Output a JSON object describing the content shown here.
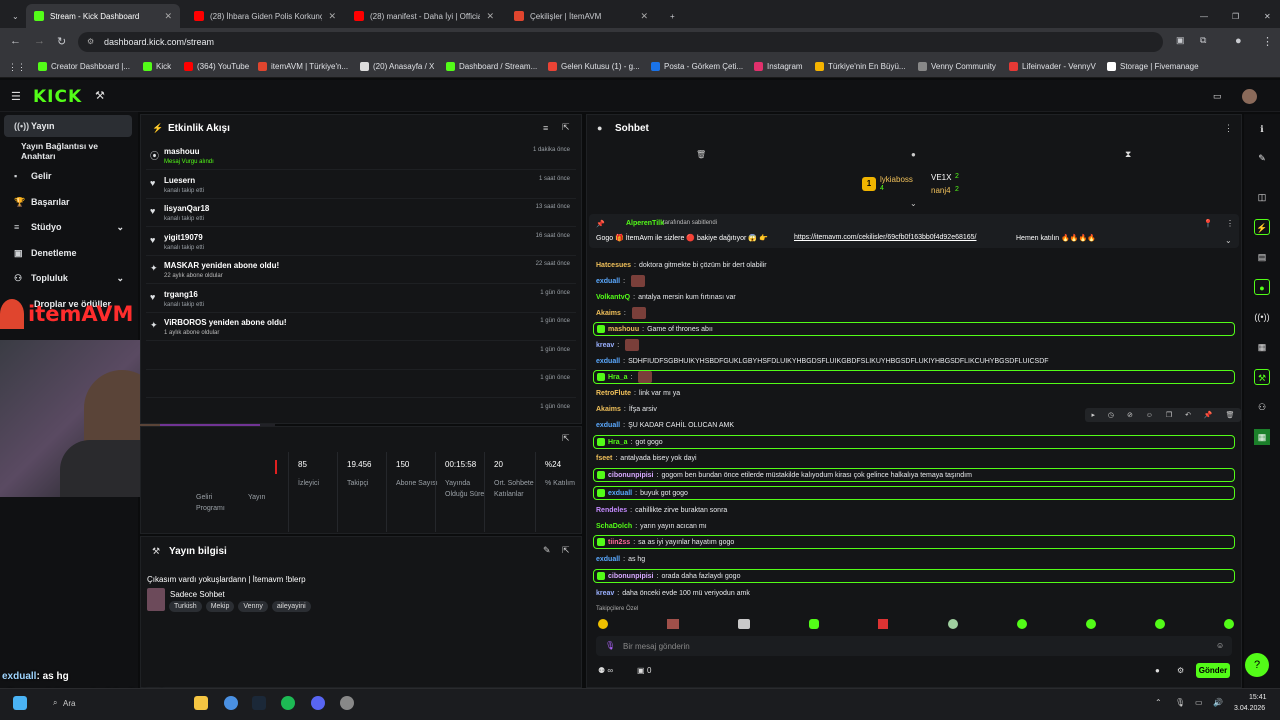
{
  "browser": {
    "tabs": [
      {
        "label": "Stream - Kick Dashboard",
        "color": "#53fc18"
      },
      {
        "label": "(28) İhbara Giden Polis Korkunç",
        "color": "#ff0000"
      },
      {
        "label": "(28) manifest - Daha İyi | Officia",
        "color": "#ff0000"
      },
      {
        "label": "Çekilişler | İtemAVM",
        "color": "#e0452e"
      }
    ],
    "url": "dashboard.kick.com/stream",
    "bookmarks": [
      "Creator Dashboard |...",
      "Kick",
      "(364) YouTube",
      "itemAVM | Türkiye'n...",
      "(20) Anasayfa / X",
      "Dashboard / Stream...",
      "Gelen Kutusu (1) - g...",
      "Posta - Görkem Çeti...",
      "Instagram",
      "Türkiye'nin En Büyü...",
      "Venny Community",
      "Lifeinvader - VennyV",
      "Storage | Fivemanage"
    ]
  },
  "kick": {
    "logo": "KICK"
  },
  "sidebar": {
    "items": [
      {
        "label": "Yayın",
        "icon": "((•))"
      },
      {
        "label": "Yayın Bağlantısı ve Anahtarı",
        "icon": ""
      },
      {
        "label": "Gelir",
        "icon": "▪"
      },
      {
        "label": "Başarılar",
        "icon": "🏆"
      },
      {
        "label": "Stüdyo",
        "icon": "≡"
      },
      {
        "label": "Denetleme",
        "icon": "▣"
      },
      {
        "label": "Topluluk",
        "icon": "⚇"
      },
      {
        "label": "Droplar ve ödüller",
        "icon": "✦"
      }
    ],
    "overlay_brand": "itemAVM"
  },
  "activity": {
    "title": "Etkinlik Akışı",
    "rows": [
      {
        "name": "mashouu",
        "sub": "Mesaj Vurgu alındı",
        "time": "1 dakika önce",
        "icon": "⦿"
      },
      {
        "name": "Luesern",
        "sub": "kanalı takip etti",
        "time": "1 saat önce",
        "icon": "♥"
      },
      {
        "name": "lisyanQar18",
        "sub": "kanalı takip etti",
        "time": "13 saat önce",
        "icon": "♥"
      },
      {
        "name": "yigit19079",
        "sub": "kanalı takip etti",
        "time": "16 saat önce",
        "icon": "♥"
      },
      {
        "name": "MASKAR yeniden abone oldu!",
        "sub": "22 aylık abone oldular",
        "time": "22 saat önce",
        "icon": "✦"
      },
      {
        "name": "trgang16",
        "sub": "kanalı takip etti",
        "time": "1 gün önce",
        "icon": "♥"
      },
      {
        "name": "ViRBOROS yeniden abone oldu!",
        "sub": "1 aylık abone oldular",
        "time": "1 gün önce",
        "icon": "✦"
      },
      {
        "name": "",
        "sub": "",
        "time": "1 gün önce",
        "icon": ""
      },
      {
        "name": "",
        "sub": "",
        "time": "1 gün önce",
        "icon": ""
      },
      {
        "name": "",
        "sub": "",
        "time": "1 gün önce",
        "icon": ""
      }
    ]
  },
  "stats": {
    "items": [
      {
        "value": "85",
        "label": "İzleyici"
      },
      {
        "value": "19.456",
        "label": "Takipçi"
      },
      {
        "value": "150",
        "label": "Abone Sayısı"
      },
      {
        "value": "00:15:58",
        "label": "Yayında Olduğu Süre"
      },
      {
        "value": "20",
        "label": "Ort. Sohbete Katılanlar"
      },
      {
        "value": "%24",
        "label": "% Katılım"
      }
    ],
    "partial": [
      "Geliri Programı",
      "Yayın"
    ]
  },
  "streaminfo": {
    "title": "Yayın bilgisi",
    "stream_title": "Çıkasım vardı yokuşlardann | İtemavm !blerp",
    "category": "Sadece Sohbet",
    "tags": [
      "Turkish",
      "Mekip",
      "Venny",
      "aileyayini"
    ]
  },
  "chat": {
    "title": "Sohbet",
    "top": {
      "user1": "lykiaboss",
      "user1_count": "4",
      "user2": "VE1X",
      "user2_count": "2",
      "user3": "nanj4",
      "user3_count": "2"
    },
    "pinned_by": "AlperenTilk",
    "pinned_suffix": "tarafından sabitlendi",
    "pinned_text": "Gogo 🎁 İtemAvm ile sizlere 🔴 bakiye dağıtıyor 😱 👉",
    "pinned_link": "https://itemavm.com/cekilisler/69cfb0f163bb0f4d92e68165/",
    "pinned_end": "Hemen katılın 🔥🔥🔥🔥",
    "messages": [
      {
        "u": "Hatcesues",
        "c": "#f0c05a",
        "t": "doktora gitmekte bi çözüm bir dert olabilir",
        "hl": false,
        "e": false
      },
      {
        "u": "exduall",
        "c": "#5aa9ff",
        "t": "",
        "hl": false,
        "e": true
      },
      {
        "u": "VolkantvQ",
        "c": "#53fc18",
        "t": "antalya mersin kum fırtınası var",
        "hl": false,
        "e": false
      },
      {
        "u": "Akaims",
        "c": "#f0c05a",
        "t": "",
        "hl": false,
        "e": true
      },
      {
        "u": "mashouu",
        "c": "#f0c05a",
        "t": "Game of thrones abıı",
        "hl": true,
        "e": false
      },
      {
        "u": "kreav",
        "c": "#9ab0ff",
        "t": "",
        "hl": false,
        "e": true
      },
      {
        "u": "exduall",
        "c": "#5aa9ff",
        "t": "SDHFIUDFSGBHUIKYHSBDFGUKLGBYHSFDLUIKYHBGDSFLUIKGBDFSLIKUYHBGSDFLUKIYHBGSDFLIKCUHYBGSDFLUICSDF",
        "hl": false,
        "e": false
      },
      {
        "u": "Hra_a",
        "c": "#53fc18",
        "t": "",
        "hl": true,
        "e": true
      },
      {
        "u": "RetroFlute",
        "c": "#f0c05a",
        "t": "link var mı ya",
        "hl": false,
        "e": false
      },
      {
        "u": "Akaims",
        "c": "#f0c05a",
        "t": "İfşa arsiv",
        "hl": false,
        "e": false
      },
      {
        "u": "exduall",
        "c": "#5aa9ff",
        "t": "ŞU KADAR CAHİL OLUCAN AMK",
        "hl": false,
        "e": false
      },
      {
        "u": "Hra_a",
        "c": "#53fc18",
        "t": "got gogo",
        "hl": true,
        "e": false
      },
      {
        "u": "fseet",
        "c": "#f0c05a",
        "t": "antalyada bisey yok dayi",
        "hl": false,
        "e": false
      },
      {
        "u": "cibonunpipisi",
        "c": "#d7a9ff",
        "t": "gogom ben bundan önce etilerde müstakilde kalıyodum kirası çok gelince halkalıya temaya taşındım",
        "hl": true,
        "e": false
      },
      {
        "u": "exduall",
        "c": "#5aa9ff",
        "t": "buyuk got gogo",
        "hl": true,
        "e": false
      },
      {
        "u": "Rendeles",
        "c": "#c58bff",
        "t": "cahillikte zirve buraktan sonra",
        "hl": false,
        "e": false
      },
      {
        "u": "SchaDolch",
        "c": "#53fc18",
        "t": "yarın yayın acıcan mı",
        "hl": false,
        "e": false
      },
      {
        "u": "tiin2ss",
        "c": "#ff6a9a",
        "t": "sa as iyi yayınlar hayatım gogo",
        "hl": true,
        "e": false
      },
      {
        "u": "exduall",
        "c": "#5aa9ff",
        "t": "as hg",
        "hl": false,
        "e": false
      },
      {
        "u": "cibonunpipisi",
        "c": "#d7a9ff",
        "t": "orada daha fazlaydı gogo",
        "hl": true,
        "e": false
      },
      {
        "u": "kreav",
        "c": "#9ab0ff",
        "t": "daha önceki evde 100 mü veriyodun amk",
        "hl": false,
        "e": false
      }
    ],
    "followers_label": "Takipçilere Özel",
    "input_placeholder": "Bir mesaj gönderin",
    "send": "Gönder",
    "count": "0"
  },
  "overlay_chat": [
    {
      "u": "exduall",
      "t": ": as hg"
    },
    {
      "u": "cibonunpipisi",
      "t": ": orada daha fazlaydı gogo"
    },
    {
      "u": "kreav",
      "t": ": daha önceki evde 100 mü veriyodun amk"
    }
  ],
  "taskbar": {
    "search": "Ara",
    "time": "15:41",
    "date": "3.04.2026"
  }
}
